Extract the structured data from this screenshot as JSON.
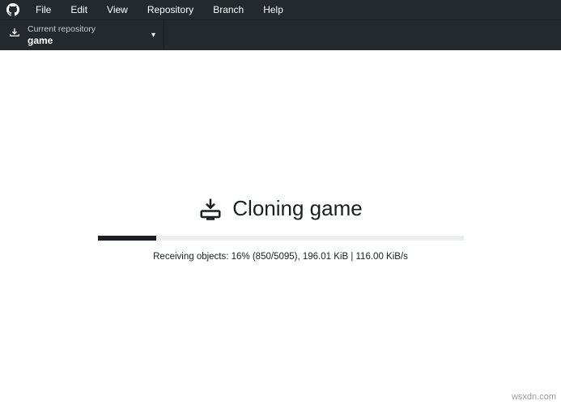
{
  "menu": {
    "items": [
      "File",
      "Edit",
      "View",
      "Repository",
      "Branch",
      "Help"
    ]
  },
  "toolbar": {
    "repo_label": "Current repository",
    "repo_value": "game"
  },
  "clone": {
    "title": "Cloning game",
    "status": "Receiving objects: 16% (850/5095), 196.01 KiB | 116.00 KiB/s",
    "progress_percent": 16
  },
  "watermark": "wsxdn.com"
}
